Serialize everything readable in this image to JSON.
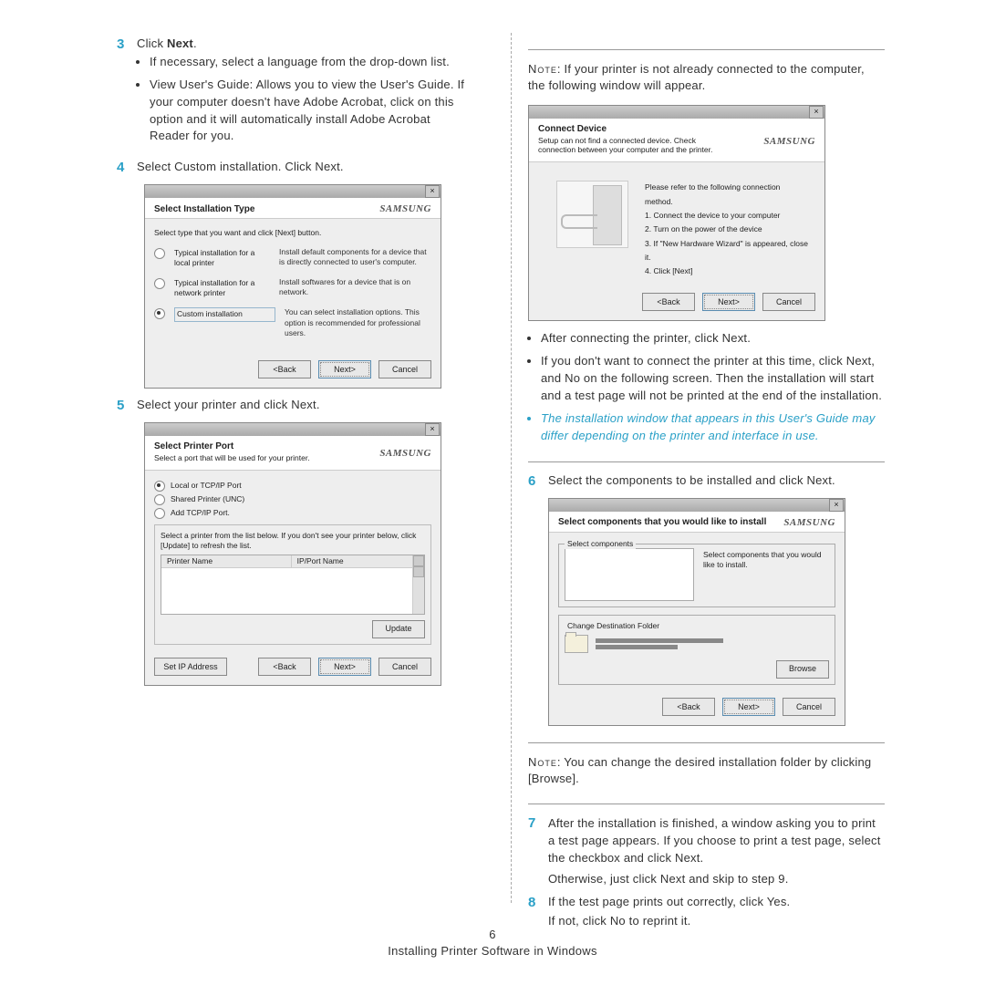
{
  "steps": {
    "s3": {
      "num": "3",
      "text_a": "Click ",
      "text_b": "Next",
      "text_c": ".",
      "bullets": [
        "If necessary, select a language from the drop-down list.",
        "View User's Guide: Allows you to view the User's Guide. If your computer doesn't have Adobe Acrobat, click on this option and it will automatically install Adobe Acrobat Reader for you."
      ]
    },
    "s4": {
      "num": "4",
      "text": "Select Custom installation. Click Next."
    },
    "s5": {
      "num": "5",
      "text": "Select your printer and click Next."
    },
    "s6": {
      "num": "6",
      "text": "Select the components to be installed and click Next."
    },
    "s7": {
      "num": "7",
      "p1": "After the installation is finished, a window asking you to print a test page appears. If you choose to print a test page, select the checkbox and click Next.",
      "p2": "Otherwise, just click Next and skip to step 9."
    },
    "s8": {
      "num": "8",
      "p1": "If the test page prints out correctly, click Yes.",
      "p2": "If not, click No to reprint it."
    }
  },
  "right": {
    "note1a": "Note",
    "note1b": ": If your printer is not already connected to the computer, the following window will appear.",
    "bullets": [
      "After connecting the printer, click Next.",
      "If you don't want to connect the printer at this time, click Next, and No on the following screen. Then the installation will start and a test page will not be printed at the end of the installation."
    ],
    "italic": "The installation window that appears in this User's Guide may differ depending on the printer and interface in use.",
    "note2a": "Note",
    "note2b": ": You can change the desired installation folder by clicking [Browse]."
  },
  "dlg1": {
    "title": "Select Installation Type",
    "sub": "Select type that you want and click [Next] button.",
    "opt1": "Typical installation for a local printer",
    "opt1d": "Install default components for a device that is directly connected to user's computer.",
    "opt2": "Typical installation for a network printer",
    "opt2d": "Install softwares for a device that is on network.",
    "opt3": "Custom installation",
    "opt3d": "You can select installation options. This option is recommended for professional users.",
    "back": "<Back",
    "next": "Next>",
    "cancel": "Cancel"
  },
  "dlg2": {
    "title": "Select Printer Port",
    "sub": "Select a port that will be used for your printer.",
    "r1": "Local or TCP/IP Port",
    "r2": "Shared Printer (UNC)",
    "r3": "Add TCP/IP Port.",
    "hint": "Select a printer from the list below. If you don't see your printer below, click [Update] to refresh the list.",
    "col1": "Printer Name",
    "col2": "IP/Port Name",
    "setip": "Set IP Address",
    "update": "Update",
    "back": "<Back",
    "next": "Next>",
    "cancel": "Cancel"
  },
  "dlg3": {
    "title": "Connect Device",
    "sub": "Setup can not find a connected device. Check connection between your computer and the printer.",
    "intro": "Please refer to the following connection method.",
    "l1": "1. Connect the device to your computer",
    "l2": "2. Turn on the power of the device",
    "l3": "3. If \"New Hardware Wizard\" is appeared, close it.",
    "l4": "4. Click [Next]",
    "back": "<Back",
    "next": "Next>",
    "cancel": "Cancel"
  },
  "dlg4": {
    "title": "Select components that you would like to install",
    "grp1": "Select components",
    "desc": "Select components that you would like to install.",
    "grp2": "Change Destination Folder",
    "browse": "Browse",
    "back": "<Back",
    "next": "Next>",
    "cancel": "Cancel"
  },
  "brand": "SAMSUNG",
  "footer": {
    "page": "6",
    "title": "Installing Printer Software in Windows"
  }
}
